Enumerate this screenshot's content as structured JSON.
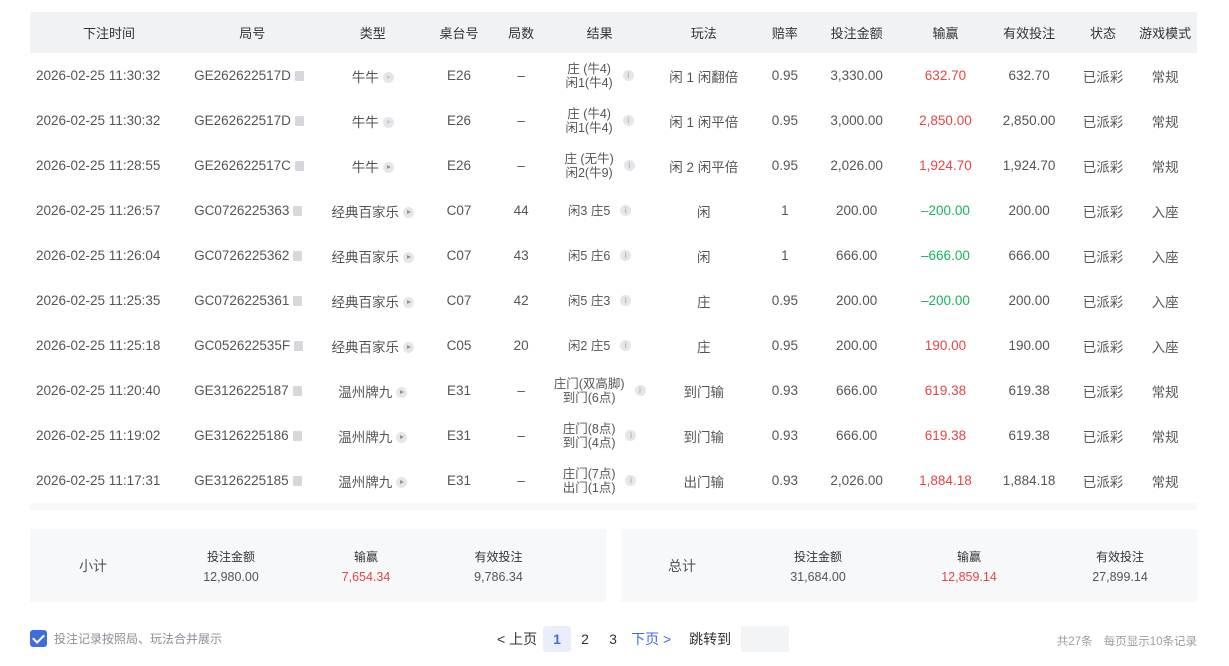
{
  "table": {
    "headers": [
      "下注时间",
      "局号",
      "类型",
      "桌台号",
      "局数",
      "结果",
      "玩法",
      "赔率",
      "投注金额",
      "输赢",
      "有效投注",
      "状态",
      "游戏模式"
    ],
    "rows": [
      {
        "time": "2026-02-25 11:30:32",
        "round": "GE262622517D",
        "type": "牛牛",
        "table": "E26",
        "count": "–",
        "result": [
          "庄 (牛4)",
          "闲1(牛4)"
        ],
        "play": "闲 1 闲翻倍",
        "odds": "0.95",
        "bet": "3,330.00",
        "win": "632.70",
        "win_sign": "pos",
        "valid": "632.70",
        "status": "已派彩",
        "mode": "常规"
      },
      {
        "time": "2026-02-25 11:30:32",
        "round": "GE262622517D",
        "type": "牛牛",
        "table": "E26",
        "count": "–",
        "result": [
          "庄 (牛4)",
          "闲1(牛4)"
        ],
        "play": "闲 1 闲平倍",
        "odds": "0.95",
        "bet": "3,000.00",
        "win": "2,850.00",
        "win_sign": "pos",
        "valid": "2,850.00",
        "status": "已派彩",
        "mode": "常规"
      },
      {
        "time": "2026-02-25 11:28:55",
        "round": "GE262622517C",
        "type": "牛牛",
        "table": "E26",
        "count": "–",
        "result": [
          "庄 (无牛)",
          "闲2(牛9)"
        ],
        "play": "闲 2 闲平倍",
        "odds": "0.95",
        "bet": "2,026.00",
        "win": "1,924.70",
        "win_sign": "pos",
        "valid": "1,924.70",
        "status": "已派彩",
        "mode": "常规"
      },
      {
        "time": "2026-02-25 11:26:57",
        "round": "GC0726225363",
        "type": "经典百家乐",
        "table": "C07",
        "count": "44",
        "result": [
          "闲3 庄5"
        ],
        "play": "闲",
        "odds": "1",
        "bet": "200.00",
        "win": "–200.00",
        "win_sign": "neg",
        "valid": "200.00",
        "status": "已派彩",
        "mode": "入座"
      },
      {
        "time": "2026-02-25 11:26:04",
        "round": "GC0726225362",
        "type": "经典百家乐",
        "table": "C07",
        "count": "43",
        "result": [
          "闲5 庄6"
        ],
        "play": "闲",
        "odds": "1",
        "bet": "666.00",
        "win": "–666.00",
        "win_sign": "neg",
        "valid": "666.00",
        "status": "已派彩",
        "mode": "入座"
      },
      {
        "time": "2026-02-25 11:25:35",
        "round": "GC0726225361",
        "type": "经典百家乐",
        "table": "C07",
        "count": "42",
        "result": [
          "闲5 庄3"
        ],
        "play": "庄",
        "odds": "0.95",
        "bet": "200.00",
        "win": "–200.00",
        "win_sign": "neg",
        "valid": "200.00",
        "status": "已派彩",
        "mode": "入座"
      },
      {
        "time": "2026-02-25 11:25:18",
        "round": "GC052622535F",
        "type": "经典百家乐",
        "table": "C05",
        "count": "20",
        "result": [
          "闲2 庄5"
        ],
        "play": "庄",
        "odds": "0.95",
        "bet": "200.00",
        "win": "190.00",
        "win_sign": "pos",
        "valid": "190.00",
        "status": "已派彩",
        "mode": "入座"
      },
      {
        "time": "2026-02-25 11:20:40",
        "round": "GE3126225187",
        "type": "温州牌九",
        "table": "E31",
        "count": "–",
        "result": [
          "庄门(双高脚)",
          "到门(6点)"
        ],
        "play": "到门输",
        "odds": "0.93",
        "bet": "666.00",
        "win": "619.38",
        "win_sign": "pos",
        "valid": "619.38",
        "status": "已派彩",
        "mode": "常规"
      },
      {
        "time": "2026-02-25 11:19:02",
        "round": "GE3126225186",
        "type": "温州牌九",
        "table": "E31",
        "count": "–",
        "result": [
          "庄门(8点)",
          "到门(4点)"
        ],
        "play": "到门输",
        "odds": "0.93",
        "bet": "666.00",
        "win": "619.38",
        "win_sign": "pos",
        "valid": "619.38",
        "status": "已派彩",
        "mode": "常规"
      },
      {
        "time": "2026-02-25 11:17:31",
        "round": "GE3126225185",
        "type": "温州牌九",
        "table": "E31",
        "count": "–",
        "result": [
          "庄门(7点)",
          "出门(1点)"
        ],
        "play": "出门输",
        "odds": "0.93",
        "bet": "2,026.00",
        "win": "1,884.18",
        "win_sign": "pos",
        "valid": "1,884.18",
        "status": "已派彩",
        "mode": "常规"
      }
    ]
  },
  "subtotal": {
    "title": "小计",
    "bet_label": "投注金额",
    "bet": "12,980.00",
    "win_label": "输赢",
    "win": "7,654.34",
    "valid_label": "有效投注",
    "valid": "9,786.34"
  },
  "total": {
    "title": "总计",
    "bet_label": "投注金额",
    "bet": "31,684.00",
    "win_label": "输赢",
    "win": "12,859.14",
    "valid_label": "有效投注",
    "valid": "27,899.14"
  },
  "footer": {
    "merge_checked": true,
    "merge_label": "投注记录按照局、玩法合并展示",
    "prev_label": "< 上页",
    "pages": [
      "1",
      "2",
      "3"
    ],
    "current_page": "1",
    "next_label": "下页 >",
    "jump_label": "跳转到",
    "total_records": "共27条",
    "per_page": "每页显示10条记录"
  },
  "colors": {
    "positive": "#e54545",
    "negative": "#18b55a",
    "accent": "#3f6ce0"
  }
}
